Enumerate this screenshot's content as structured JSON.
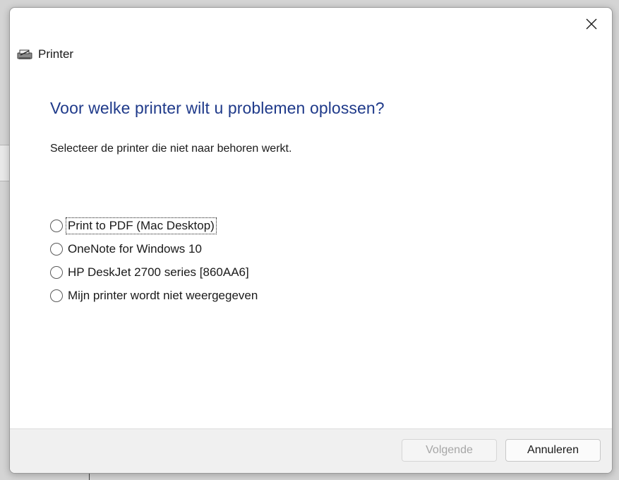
{
  "window": {
    "title": "Printer",
    "close_glyph": "✕",
    "icon": "printer-icon"
  },
  "page": {
    "heading": "Voor welke printer wilt u problemen oplossen?",
    "instruction": "Selecteer de printer die niet naar behoren werkt."
  },
  "printers": [
    {
      "label": "Print to PDF (Mac Desktop)",
      "selected": false,
      "focused": true
    },
    {
      "label": "OneNote for Windows 10",
      "selected": false,
      "focused": false
    },
    {
      "label": "HP DeskJet 2700 series [860AA6]",
      "selected": false,
      "focused": false
    },
    {
      "label": "Mijn printer wordt niet weergegeven",
      "selected": false,
      "focused": false
    }
  ],
  "footer": {
    "next_label": "Volgende",
    "next_disabled": true,
    "cancel_label": "Annuleren"
  },
  "colors": {
    "heading": "#1f3a8a",
    "disabled_text": "#a6a6a6"
  }
}
